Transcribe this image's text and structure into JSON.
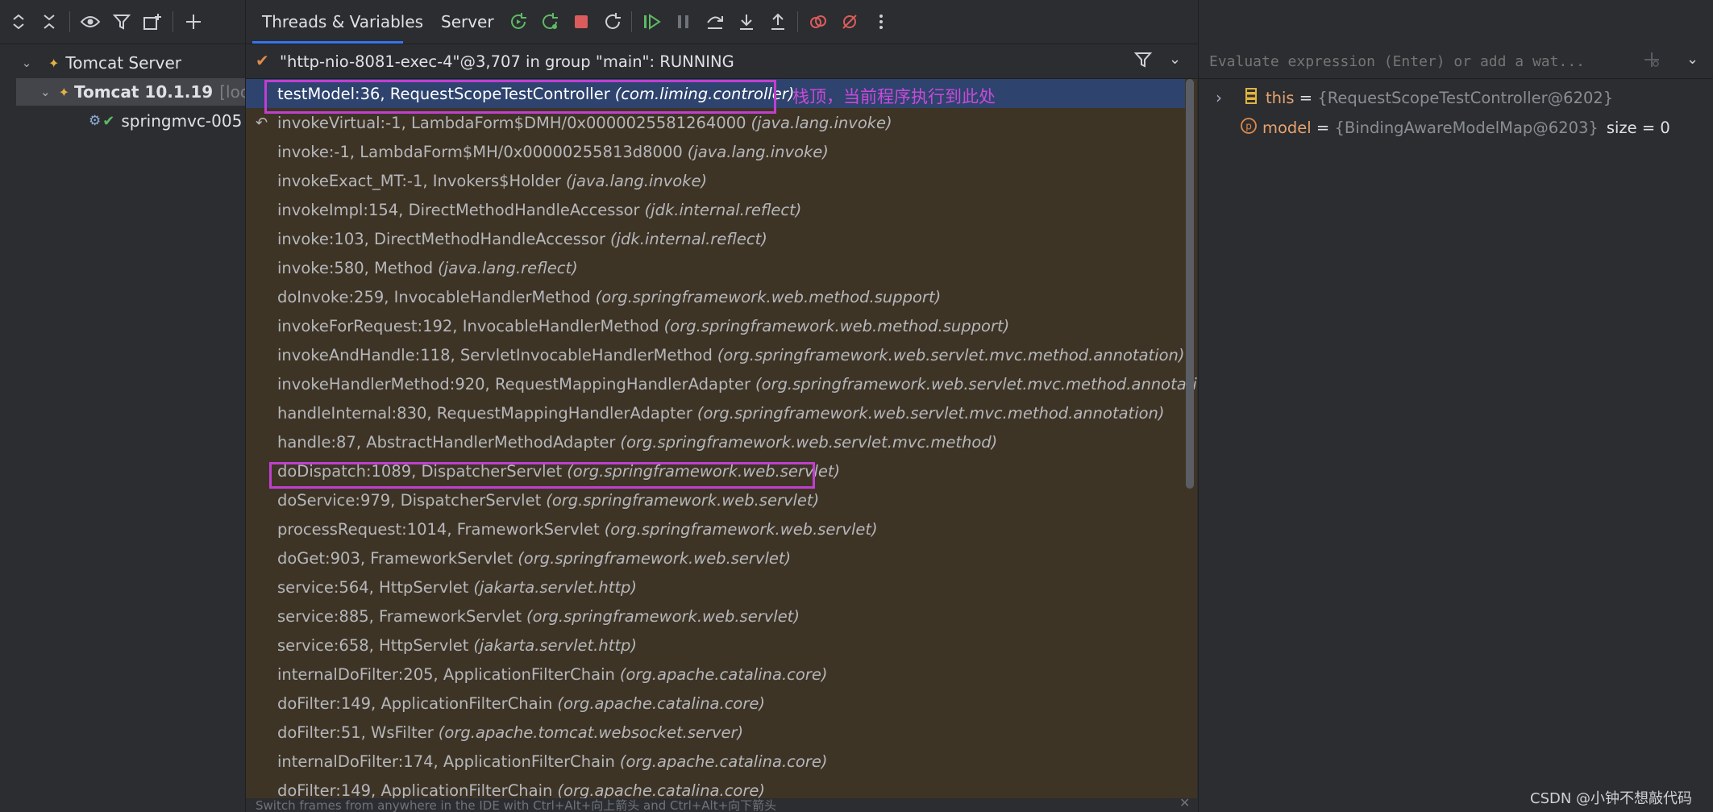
{
  "left_panel": {
    "toolbar_icons": [
      "expand-all-icon",
      "collapse-all-icon",
      "eye-icon",
      "filter-icon",
      "new-tab-icon",
      "add-icon"
    ],
    "tree": [
      {
        "label": "Tomcat Server",
        "extra": ""
      },
      {
        "label": "Tomcat 10.1.19",
        "extra": "[loca"
      },
      {
        "label": "springmvc-005",
        "extra": ""
      }
    ]
  },
  "tabs": {
    "threads_variables": "Threads & Variables",
    "server": "Server"
  },
  "thread": {
    "status": "\"http-nio-8081-exec-4\"@3,707 in group \"main\": RUNNING"
  },
  "frames": [
    {
      "name": "testModel:36, RequestScopeTestController",
      "pkg": "(com.liming.controller)"
    },
    {
      "name": "invokeVirtual:-1, LambdaForm$DMH/0x0000025581264000",
      "pkg": "(java.lang.invoke)"
    },
    {
      "name": "invoke:-1, LambdaForm$MH/0x00000255813d8000",
      "pkg": "(java.lang.invoke)"
    },
    {
      "name": "invokeExact_MT:-1, Invokers$Holder",
      "pkg": "(java.lang.invoke)"
    },
    {
      "name": "invokeImpl:154, DirectMethodHandleAccessor",
      "pkg": "(jdk.internal.reflect)"
    },
    {
      "name": "invoke:103, DirectMethodHandleAccessor",
      "pkg": "(jdk.internal.reflect)"
    },
    {
      "name": "invoke:580, Method",
      "pkg": "(java.lang.reflect)"
    },
    {
      "name": "doInvoke:259, InvocableHandlerMethod",
      "pkg": "(org.springframework.web.method.support)"
    },
    {
      "name": "invokeForRequest:192, InvocableHandlerMethod",
      "pkg": "(org.springframework.web.method.support)"
    },
    {
      "name": "invokeAndHandle:118, ServletInvocableHandlerMethod",
      "pkg": "(org.springframework.web.servlet.mvc.method.annotation)"
    },
    {
      "name": "invokeHandlerMethod:920, RequestMappingHandlerAdapter",
      "pkg": "(org.springframework.web.servlet.mvc.method.annotation)"
    },
    {
      "name": "handleInternal:830, RequestMappingHandlerAdapter",
      "pkg": "(org.springframework.web.servlet.mvc.method.annotation)"
    },
    {
      "name": "handle:87, AbstractHandlerMethodAdapter",
      "pkg": "(org.springframework.web.servlet.mvc.method)"
    },
    {
      "name": "doDispatch:1089, DispatcherServlet",
      "pkg": "(org.springframework.web.servlet)"
    },
    {
      "name": "doService:979, DispatcherServlet",
      "pkg": "(org.springframework.web.servlet)"
    },
    {
      "name": "processRequest:1014, FrameworkServlet",
      "pkg": "(org.springframework.web.servlet)"
    },
    {
      "name": "doGet:903, FrameworkServlet",
      "pkg": "(org.springframework.web.servlet)"
    },
    {
      "name": "service:564, HttpServlet",
      "pkg": "(jakarta.servlet.http)"
    },
    {
      "name": "service:885, FrameworkServlet",
      "pkg": "(org.springframework.web.servlet)"
    },
    {
      "name": "service:658, HttpServlet",
      "pkg": "(jakarta.servlet.http)"
    },
    {
      "name": "internalDoFilter:205, ApplicationFilterChain",
      "pkg": "(org.apache.catalina.core)"
    },
    {
      "name": "doFilter:149, ApplicationFilterChain",
      "pkg": "(org.apache.catalina.core)"
    },
    {
      "name": "doFilter:51, WsFilter",
      "pkg": "(org.apache.tomcat.websocket.server)"
    },
    {
      "name": "internalDoFilter:174, ApplicationFilterChain",
      "pkg": "(org.apache.catalina.core)"
    },
    {
      "name": "doFilter:149, ApplicationFilterChain",
      "pkg": "(org.apache.catalina.core)"
    }
  ],
  "annotation": "栈顶，当前程序执行到此处",
  "hint": "Switch frames from anywhere in the IDE with Ctrl+Alt+向上箭头 and Ctrl+Alt+向下箭头",
  "evaluate": {
    "placeholder": "Evaluate expression (Enter) or add a wat..."
  },
  "variables": [
    {
      "name": "this",
      "eq": " = ",
      "value": "{RequestScopeTestController@6202}",
      "extra": ""
    },
    {
      "name": "model",
      "eq": " = ",
      "value": "{BindingAwareModelMap@6203}",
      "extra": "size = 0"
    }
  ],
  "watermark": "CSDN @小钟不想敲代码",
  "colors": {
    "selected_row": "#2e436e",
    "frames_bg": "#3e3426",
    "highlight_box": "#c03fd0",
    "variable_name": "#e8a36e"
  }
}
